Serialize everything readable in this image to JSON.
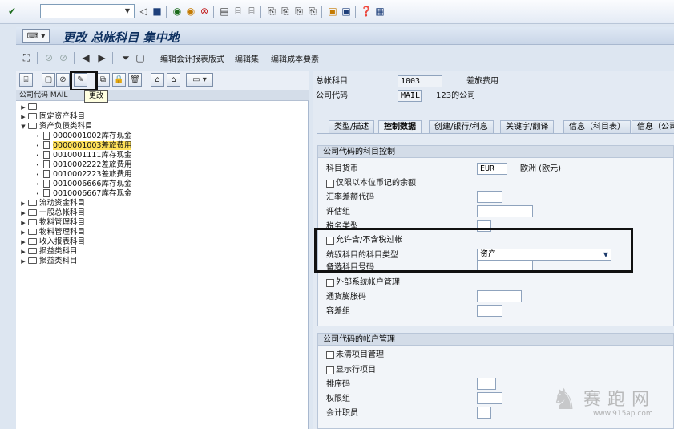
{
  "toolbar": {
    "command_field_value": "",
    "icons": [
      "check-icon",
      "back-icon",
      "save-icon",
      "exit-icon",
      "cancel-icon",
      "stop-icon",
      "print-icon",
      "find-icon",
      "find-next-icon",
      "first-page-icon",
      "prev-page-icon",
      "next-page-icon",
      "last-page-icon",
      "new-session-icon",
      "shortcut-icon",
      "help-icon",
      "layout-icon"
    ]
  },
  "title": "更改 总帐科目 集中地",
  "toolbar2": {
    "items": [
      "编辑会计报表版式",
      "编辑集",
      "编辑成本要素"
    ]
  },
  "left_panel": {
    "header": "公司代码 MAIL",
    "tooltip": "更改",
    "tree": [
      {
        "level": 0,
        "type": "folder",
        "label": "",
        "expanded": false
      },
      {
        "level": 0,
        "type": "folder",
        "label": "固定资产科目",
        "expanded": false
      },
      {
        "level": 0,
        "type": "folder",
        "label": "资产负债类科目",
        "expanded": true
      },
      {
        "level": 1,
        "type": "doc",
        "label": "0000001002库存现金"
      },
      {
        "level": 1,
        "type": "doc",
        "label": "0000001003差旅费用",
        "selected": true
      },
      {
        "level": 1,
        "type": "doc",
        "label": "0010001111库存现金"
      },
      {
        "level": 1,
        "type": "doc",
        "label": "0010002222差旅费用"
      },
      {
        "level": 1,
        "type": "doc",
        "label": "0010002223差旅费用"
      },
      {
        "level": 1,
        "type": "doc",
        "label": "0010006666库存现金"
      },
      {
        "level": 1,
        "type": "doc",
        "label": "0010006667库存现金"
      },
      {
        "level": 0,
        "type": "folder",
        "label": "流动资金科目",
        "expanded": false
      },
      {
        "level": 0,
        "type": "folder",
        "label": "一般总帐科目",
        "expanded": false
      },
      {
        "level": 0,
        "type": "folder",
        "label": "物料管理科目",
        "expanded": false
      },
      {
        "level": 0,
        "type": "folder",
        "label": "物料管理科目",
        "expanded": false
      },
      {
        "level": 0,
        "type": "folder",
        "label": "收入报表科目",
        "expanded": false
      },
      {
        "level": 0,
        "type": "folder",
        "label": "损益类科目",
        "expanded": false
      },
      {
        "level": 0,
        "type": "folder",
        "label": "损益类科目",
        "expanded": false
      }
    ]
  },
  "header_fields": {
    "gl_account_label": "总帐科目",
    "gl_account_value": "1003",
    "gl_account_desc": "差旅费用",
    "company_code_label": "公司代码",
    "company_code_value": "MAIL",
    "company_code_desc": "123的公司"
  },
  "tabs": [
    "类型/描述",
    "控制数据",
    "创建/银行/利息",
    "关键字/翻译",
    "信息（科目表）",
    "信息（公司"
  ],
  "active_tab": 1,
  "section1": {
    "title": "公司代码的科目控制",
    "currency_label": "科目货币",
    "currency_value": "EUR",
    "currency_desc": "欧洲 (欧元)",
    "local_currency_only_label": "仅限以本位币记的余额",
    "exchange_diff_label": "汇率差额代码",
    "valuation_group_label": "评估组",
    "tax_category_label": "税务类型",
    "allow_no_tax_label": "允许含/不含税过帐",
    "recon_account_label": "统驭科目的科目类型",
    "recon_account_value": "资产",
    "alt_account_label": "备选科目号码",
    "external_mgmt_label": "外部系统帐户管理",
    "inflation_key_label": "通货膨胀码",
    "tolerance_group_label": "容差组"
  },
  "section2": {
    "title": "公司代码的帐户管理",
    "open_item_label": "未清项目管理",
    "line_item_label": "显示行项目",
    "sort_key_label": "排序码",
    "auth_group_label": "权限组",
    "accounting_clerk_label": "会计职员"
  },
  "watermark": {
    "text": "赛跑网",
    "url": "www.915ap.com"
  }
}
